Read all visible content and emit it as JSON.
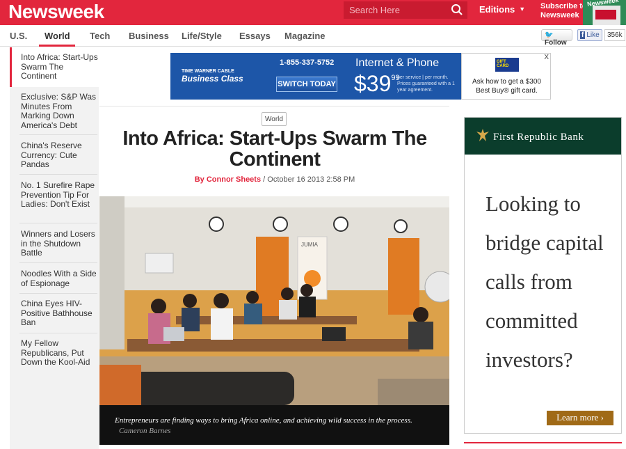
{
  "header": {
    "logo": "Newsweek",
    "search_placeholder": "Search Here",
    "editions_label": "Editions",
    "subscribe_line1": "Subscribe to",
    "subscribe_line2": "Newsweek",
    "magazine_thumb_text": "Newsweek"
  },
  "nav": {
    "items": [
      "U.S.",
      "World",
      "Tech",
      "Business",
      "Life/Style",
      "Essays",
      "Magazine"
    ],
    "active": "World",
    "twitter_label": "Follow",
    "facebook_label": "Like",
    "facebook_count": "356k"
  },
  "sidebar": {
    "items": [
      {
        "label": "Into Africa: Start-Ups Swarm The Continent"
      },
      {
        "label": "Exclusive: S&P Was Minutes From Marking Down America's Debt"
      },
      {
        "label": "China's Reserve Currency: Cute Pandas"
      },
      {
        "label": "No. 1 Surefire Rape Prevention Tip For Ladies: Don't Exist"
      },
      {
        "label": "Winners and Losers in the Shutdown Battle"
      },
      {
        "label": "Noodles With a Side of Espionage"
      },
      {
        "label": "China Eyes HIV-Positive Bathhouse Ban"
      },
      {
        "label": "My Fellow Republicans, Put Down the Kool-Aid"
      }
    ]
  },
  "banner_ad": {
    "brand_small": "TIME WARNER CABLE",
    "brand_big": "Business Class",
    "phone": "1-855-337-5752",
    "cta": "SWITCH TODAY",
    "product": "Internet & Phone",
    "price_dollars": "$39",
    "price_cents": "99",
    "price_fine": "per service | per month. Prices guaranteed with a 1 year agreement.",
    "gift_tag": "GIFT CARD",
    "gift_text": "Ask how to get a $300 Best Buy® gift card.",
    "close": "X"
  },
  "article": {
    "section_tag": "World",
    "headline": "Into Africa: Start-Ups Swarm The Continent",
    "author": "By Connor Sheets",
    "date": "/ October 16 2013 2:58 PM",
    "photo_sign": "JUMIA",
    "caption": "Entrepreneurs are finding ways to bring Africa online, and achieving wild success in the process.",
    "credit": "Cameron Barnes"
  },
  "right_ad": {
    "brand": "First Republic Bank",
    "copy": "Looking to bridge capital calls from committed investors?",
    "cta": "Learn more ›"
  },
  "colors": {
    "brand_red": "#e2263d",
    "ad_blue": "#1d56a8",
    "bank_green": "#0b3d2c",
    "bank_gold": "#a06a17"
  }
}
